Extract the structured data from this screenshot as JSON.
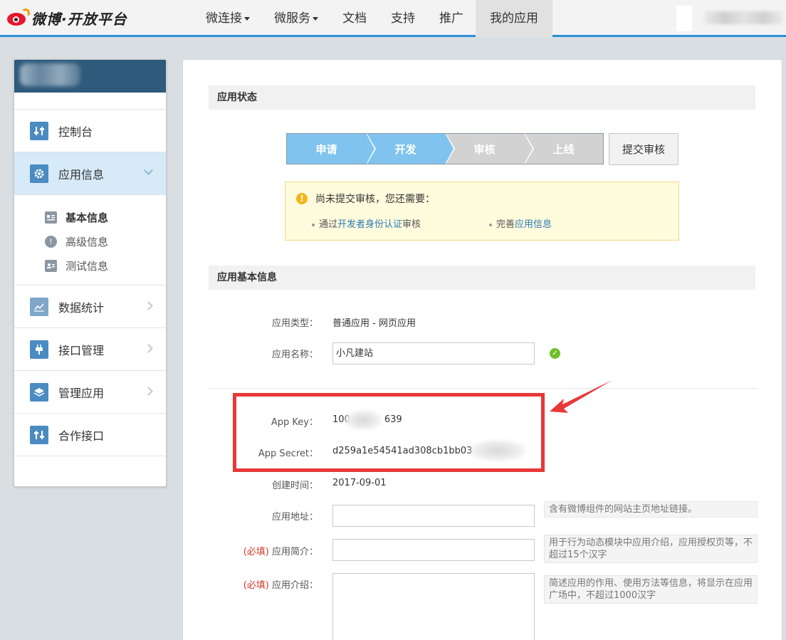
{
  "brand": {
    "logo_text": "微博·开放平台"
  },
  "nav": {
    "items": [
      {
        "label": "微连接",
        "has_caret": true
      },
      {
        "label": "微服务",
        "has_caret": true
      },
      {
        "label": "文档"
      },
      {
        "label": "支持"
      },
      {
        "label": "推广"
      },
      {
        "label": "我的应用",
        "active": true
      }
    ]
  },
  "sidebar": {
    "items": [
      {
        "label": "控制台",
        "icon": "dashboard-icon"
      },
      {
        "label": "应用信息",
        "icon": "gear-icon",
        "active": true
      },
      {
        "label": "数据统计",
        "icon": "chart-icon"
      },
      {
        "label": "接口管理",
        "icon": "plug-icon"
      },
      {
        "label": "管理应用",
        "icon": "layers-icon"
      },
      {
        "label": "合作接口",
        "icon": "sliders-icon"
      }
    ],
    "sub_items": [
      {
        "label": "基本信息",
        "icon": "id-card-icon",
        "active": true
      },
      {
        "label": "高级信息",
        "icon": "exclamation-icon"
      },
      {
        "label": "测试信息",
        "icon": "test-icon"
      }
    ]
  },
  "status": {
    "section_title": "应用状态",
    "steps": [
      {
        "label": "申请",
        "state": "done"
      },
      {
        "label": "开发",
        "state": "done"
      },
      {
        "label": "审核",
        "state": "todo"
      },
      {
        "label": "上线",
        "state": "todo"
      }
    ],
    "submit_label": "提交审核",
    "notice": {
      "title": "尚未提交审核，您还需要：",
      "req1_prefix": "通过",
      "req1_link": "开发者身份认证",
      "req1_suffix": "审核",
      "req2_prefix": "完善",
      "req2_link": "应用信息"
    }
  },
  "basic": {
    "section_title": "应用基本信息",
    "app_type_label": "应用类型：",
    "app_type_value": "普通应用  -  网页应用",
    "app_name_label": "应用名称：",
    "app_name_value": "小凡建站",
    "app_key_label": "App Key：",
    "app_key_prefix": "100",
    "app_key_suffix": "639",
    "app_secret_label": "App Secret：",
    "app_secret_value": "d259a1e54541ad308cb1bb03",
    "created_label": "创建时间：",
    "created_value": "2017-09-01",
    "url_label": "应用地址：",
    "url_hint": "含有微博组件的网站主页地址链接。",
    "required_tag": "(必填)",
    "summary_label": "应用简介：",
    "summary_hint": "用于行为动态模块中应用介绍，应用授权页等，不超过15个汉字",
    "intro_label": "应用介绍：",
    "intro_hint": "简述应用的作用、使用方法等信息，将显示在应用广场中，不超过1000汉字"
  },
  "colors": {
    "nav_accent": "#2b8fd6",
    "sidebar_head": "#2e5a7b",
    "step_done": "#80c3ef",
    "step_todo": "#d2d2d2",
    "highlight": "#e83838",
    "required": "#d23c2f",
    "link": "#2b79b5"
  }
}
